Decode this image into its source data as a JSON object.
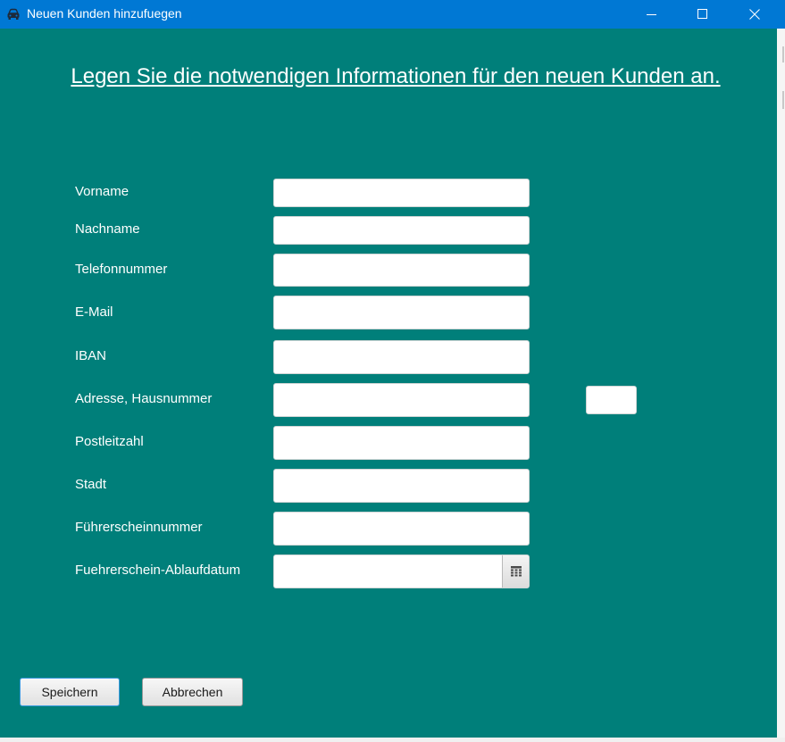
{
  "window": {
    "title": "Neuen Kunden hinzufuegen",
    "icon": "car-icon",
    "controls": [
      "minimize-icon",
      "maximize-icon",
      "close-icon"
    ],
    "titlebar_color": "#0078d4"
  },
  "form": {
    "heading": "Legen Sie die notwendigen Informationen für den neuen Kunden an.",
    "background_color": "#007f7a",
    "fields": [
      {
        "label": "Vorname",
        "value": ""
      },
      {
        "label": "Nachname",
        "value": ""
      },
      {
        "label": "Telefonnummer",
        "value": ""
      },
      {
        "label": "E-Mail",
        "value": ""
      },
      {
        "label": "IBAN",
        "value": ""
      },
      {
        "label": "Adresse, Hausnummer",
        "value": ""
      },
      {
        "label": "Postleitzahl",
        "value": ""
      },
      {
        "label": "Stadt",
        "value": ""
      },
      {
        "label": "Führerscheinnummer",
        "value": ""
      },
      {
        "label": "Fuehrerschein-Ablaufdatum",
        "value": "",
        "picker_icon": "calendar-icon"
      }
    ],
    "house_number_value": ""
  },
  "buttons": {
    "save_label": "Speichern",
    "cancel_label": "Abbrechen",
    "focus_color": "#3b9be0"
  }
}
